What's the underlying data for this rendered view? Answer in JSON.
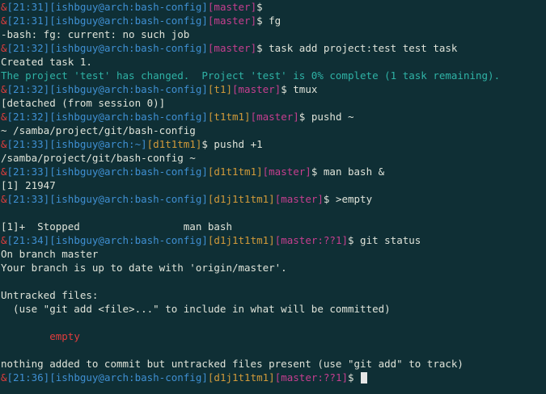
{
  "terminal": {
    "lines": [
      [
        {
          "t": "&",
          "c": "red"
        },
        {
          "t": "[21:31]",
          "c": "blue"
        },
        {
          "t": "[ishbguy@arch:bash-config]",
          "c": "blue"
        },
        {
          "t": "[master]",
          "c": "magenta"
        },
        {
          "t": "$",
          "c": "normal"
        }
      ],
      [
        {
          "t": "&",
          "c": "red"
        },
        {
          "t": "[21:31]",
          "c": "blue"
        },
        {
          "t": "[ishbguy@arch:bash-config]",
          "c": "blue"
        },
        {
          "t": "[master]",
          "c": "magenta"
        },
        {
          "t": "$ fg",
          "c": "normal"
        }
      ],
      [
        {
          "t": "-bash: fg: current: no such job",
          "c": "normal"
        }
      ],
      [
        {
          "t": "&",
          "c": "red"
        },
        {
          "t": "[21:32]",
          "c": "blue"
        },
        {
          "t": "[ishbguy@arch:bash-config]",
          "c": "blue"
        },
        {
          "t": "[master]",
          "c": "magenta"
        },
        {
          "t": "$ task add project:test test task",
          "c": "normal"
        }
      ],
      [
        {
          "t": "Created task 1.",
          "c": "normal"
        }
      ],
      [
        {
          "t": "The project 'test' has changed.  Project 'test' is 0% complete (1 task remaining).",
          "c": "cyan"
        }
      ],
      [
        {
          "t": "&",
          "c": "red"
        },
        {
          "t": "[21:32]",
          "c": "blue"
        },
        {
          "t": "[ishbguy@arch:bash-config]",
          "c": "blue"
        },
        {
          "t": "[t1]",
          "c": "orange"
        },
        {
          "t": "[master]",
          "c": "magenta"
        },
        {
          "t": "$ tmux",
          "c": "normal"
        }
      ],
      [
        {
          "t": "[detached (from session 0)]",
          "c": "normal"
        }
      ],
      [
        {
          "t": "&",
          "c": "red"
        },
        {
          "t": "[21:32]",
          "c": "blue"
        },
        {
          "t": "[ishbguy@arch:bash-config]",
          "c": "blue"
        },
        {
          "t": "[t1tm1]",
          "c": "orange"
        },
        {
          "t": "[master]",
          "c": "magenta"
        },
        {
          "t": "$ pushd ~",
          "c": "normal"
        }
      ],
      [
        {
          "t": "~ /samba/project/git/bash-config",
          "c": "normal"
        }
      ],
      [
        {
          "t": "&",
          "c": "red"
        },
        {
          "t": "[21:33]",
          "c": "blue"
        },
        {
          "t": "[ishbguy@arch:~]",
          "c": "blue"
        },
        {
          "t": "[d1t1tm1]",
          "c": "orange"
        },
        {
          "t": "$ pushd +1",
          "c": "normal"
        }
      ],
      [
        {
          "t": "/samba/project/git/bash-config ~",
          "c": "normal"
        }
      ],
      [
        {
          "t": "&",
          "c": "red"
        },
        {
          "t": "[21:33]",
          "c": "blue"
        },
        {
          "t": "[ishbguy@arch:bash-config]",
          "c": "blue"
        },
        {
          "t": "[d1t1tm1]",
          "c": "orange"
        },
        {
          "t": "[master]",
          "c": "magenta"
        },
        {
          "t": "$ man bash &",
          "c": "normal"
        }
      ],
      [
        {
          "t": "[1] 21947",
          "c": "normal"
        }
      ],
      [
        {
          "t": "&",
          "c": "red"
        },
        {
          "t": "[21:33]",
          "c": "blue"
        },
        {
          "t": "[ishbguy@arch:bash-config]",
          "c": "blue"
        },
        {
          "t": "[d1j1t1tm1]",
          "c": "orange"
        },
        {
          "t": "[master]",
          "c": "magenta"
        },
        {
          "t": "$ >empty",
          "c": "normal"
        }
      ],
      [
        {
          "t": "",
          "c": "normal"
        }
      ],
      [
        {
          "t": "[1]+  Stopped                 man bash",
          "c": "normal"
        }
      ],
      [
        {
          "t": "&",
          "c": "red"
        },
        {
          "t": "[21:34]",
          "c": "blue"
        },
        {
          "t": "[ishbguy@arch:bash-config]",
          "c": "blue"
        },
        {
          "t": "[d1j1t1tm1]",
          "c": "orange"
        },
        {
          "t": "[master:??1]",
          "c": "magenta"
        },
        {
          "t": "$ git status",
          "c": "normal"
        }
      ],
      [
        {
          "t": "On branch master",
          "c": "normal"
        }
      ],
      [
        {
          "t": "Your branch is up to date with 'origin/master'.",
          "c": "normal"
        }
      ],
      [
        {
          "t": "",
          "c": "normal"
        }
      ],
      [
        {
          "t": "Untracked files:",
          "c": "normal"
        }
      ],
      [
        {
          "t": "  (use \"git add <file>...\" to include in what will be committed)",
          "c": "normal"
        }
      ],
      [
        {
          "t": "",
          "c": "normal"
        }
      ],
      [
        {
          "t": "        ",
          "c": "normal"
        },
        {
          "t": "empty",
          "c": "red"
        }
      ],
      [
        {
          "t": "",
          "c": "normal"
        }
      ],
      [
        {
          "t": "nothing added to commit but untracked files present (use \"git add\" to track)",
          "c": "normal"
        }
      ],
      [
        {
          "t": "&",
          "c": "red"
        },
        {
          "t": "[21:36]",
          "c": "blue"
        },
        {
          "t": "[ishbguy@arch:bash-config]",
          "c": "blue"
        },
        {
          "t": "[d1j1t1tm1]",
          "c": "orange"
        },
        {
          "t": "[master:??1]",
          "c": "magenta"
        },
        {
          "t": "$ ",
          "c": "normal"
        }
      ]
    ]
  }
}
